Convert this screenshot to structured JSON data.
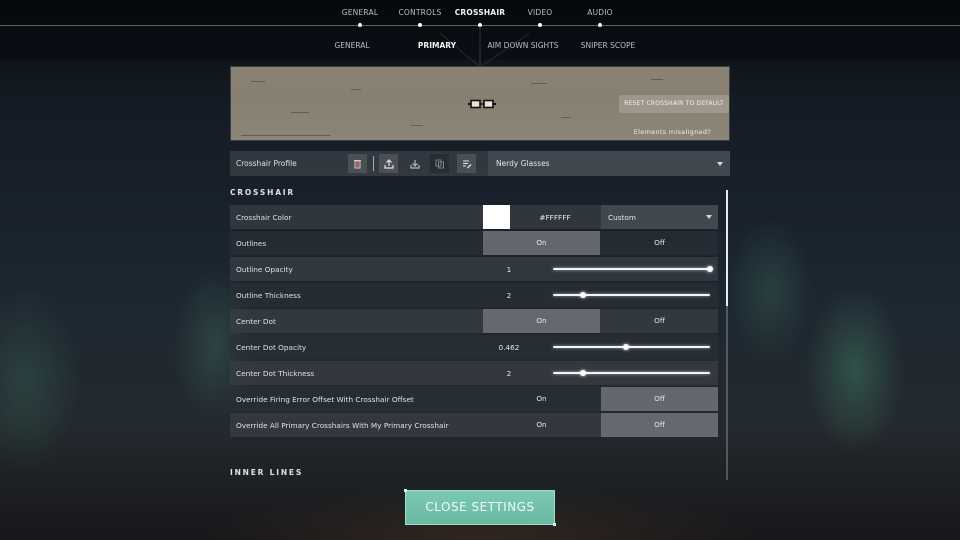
{
  "top_tabs": [
    {
      "label": "GENERAL",
      "active": false
    },
    {
      "label": "CONTROLS",
      "active": false
    },
    {
      "label": "CROSSHAIR",
      "active": true
    },
    {
      "label": "VIDEO",
      "active": false
    },
    {
      "label": "AUDIO",
      "active": false
    }
  ],
  "sub_tabs": [
    {
      "label": "GENERAL",
      "active": false
    },
    {
      "label": "PRIMARY",
      "active": true
    },
    {
      "label": "AIM DOWN SIGHTS",
      "active": false
    },
    {
      "label": "SNIPER SCOPE",
      "active": false
    }
  ],
  "preview": {
    "reset_label": "RESET CROSSHAIR TO DEFAULT",
    "misaligned_label": "Elements misaligned?"
  },
  "profile": {
    "label": "Crosshair Profile",
    "icons": [
      "delete-icon",
      "export-icon",
      "import-icon",
      "copy-icon",
      "rename-icon"
    ],
    "selected": "Nerdy Glasses"
  },
  "sections": {
    "crosshair": "CROSSHAIR",
    "inner_lines": "INNER LINES"
  },
  "settings": {
    "crosshair_color": {
      "label": "Crosshair Color",
      "swatch": "#FFFFFF",
      "hex": "#FFFFFF",
      "preset": "Custom"
    },
    "outlines": {
      "label": "Outlines",
      "on": "On",
      "off": "Off",
      "value": "On"
    },
    "outline_opacity": {
      "label": "Outline Opacity",
      "value": "1",
      "fraction": 1.0
    },
    "outline_thickness": {
      "label": "Outline Thickness",
      "value": "2",
      "fraction": 0.19
    },
    "center_dot": {
      "label": "Center Dot",
      "on": "On",
      "off": "Off",
      "value": "On"
    },
    "center_dot_opacity": {
      "label": "Center Dot Opacity",
      "value": "0.462",
      "fraction": 0.462
    },
    "center_dot_thickness": {
      "label": "Center Dot Thickness",
      "value": "2",
      "fraction": 0.19
    },
    "override_firing_error": {
      "label": "Override Firing Error Offset With Crosshair Offset",
      "on": "On",
      "off": "Off",
      "value": "Off"
    },
    "override_all_primary": {
      "label": "Override All Primary Crosshairs With My Primary Crosshair",
      "on": "On",
      "off": "Off",
      "value": "Off"
    }
  },
  "scroll": {
    "position_fraction": 0.0,
    "visible_fraction": 0.4
  },
  "close_button": "CLOSE SETTINGS"
}
